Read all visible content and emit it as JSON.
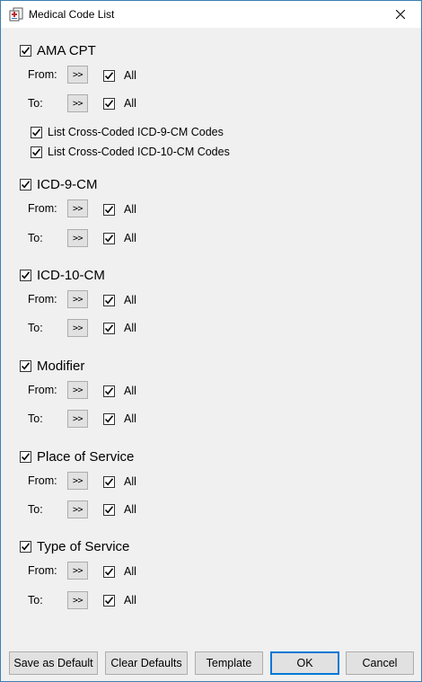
{
  "window": {
    "title": "Medical Code List"
  },
  "labels": {
    "from": "From:",
    "to": "To:",
    "all": "All",
    "arrow": ">>"
  },
  "sections": [
    {
      "id": "ama-cpt",
      "label": "AMA CPT",
      "checked": true
    },
    {
      "id": "icd-9-cm",
      "label": "ICD-9-CM",
      "checked": true
    },
    {
      "id": "icd-10-cm",
      "label": "ICD-10-CM",
      "checked": true
    },
    {
      "id": "modifier",
      "label": "Modifier",
      "checked": true
    },
    {
      "id": "place-of-service",
      "label": "Place of Service",
      "checked": true
    },
    {
      "id": "type-of-service",
      "label": "Type of Service",
      "checked": true
    }
  ],
  "cross_coded": {
    "icd9": "List Cross-Coded ICD-9-CM Codes",
    "icd10": "List Cross-Coded ICD-10-CM Codes"
  },
  "buttons": {
    "save_default": "Save as Default",
    "clear_defaults": "Clear Defaults",
    "template": "Template",
    "ok": "OK",
    "cancel": "Cancel"
  }
}
